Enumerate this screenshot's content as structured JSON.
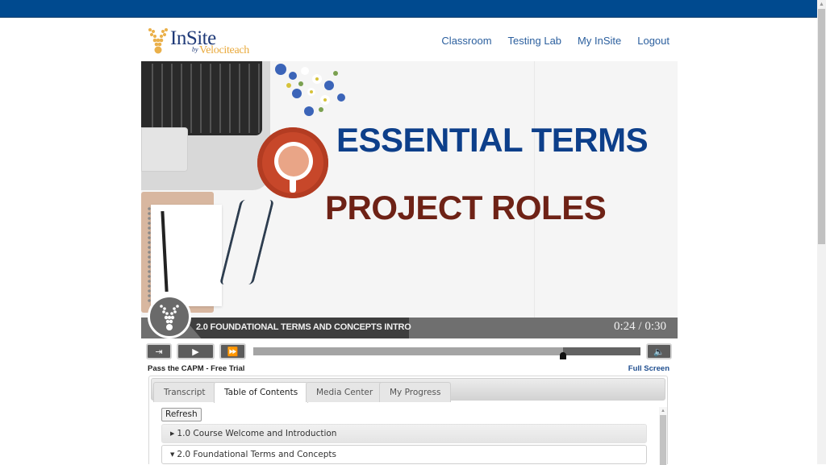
{
  "header": {
    "logo_primary": "InSite",
    "logo_by": "by",
    "logo_secondary": "Velociteach",
    "nav": [
      {
        "label": "Classroom"
      },
      {
        "label": "Testing Lab"
      },
      {
        "label": "My InSite"
      },
      {
        "label": "Logout"
      }
    ]
  },
  "video": {
    "slide_title_line1": "ESSENTIAL TERMS",
    "slide_title_line2": "PROJECT ROLES",
    "caption": "2.0 FOUNDATIONAL TERMS AND CONCEPTS INTRO",
    "time_current": "0:24",
    "time_separator": "/",
    "time_total": "0:30",
    "progress_fraction": 0.8,
    "colors": {
      "title_blue": "#0d3f8a",
      "title_red": "#6e2216"
    }
  },
  "controls": {
    "exit_icon": "exit-icon",
    "play_icon": "play-icon",
    "forward_icon": "fast-forward-icon",
    "volume_icon": "volume-icon"
  },
  "course": {
    "name": "Pass the CAPM - Free Trial",
    "fullscreen_label": "Full Screen"
  },
  "tabs": [
    {
      "label": "Transcript",
      "active": false
    },
    {
      "label": "Table of Contents",
      "active": true
    },
    {
      "label": "Media Center",
      "active": false
    },
    {
      "label": "My Progress",
      "active": false
    }
  ],
  "toc": {
    "refresh_label": "Refresh",
    "items": [
      {
        "label": "1.0 Course Welcome and Introduction",
        "expanded": false
      },
      {
        "label": "2.0 Foundational Terms and Concepts",
        "expanded": true
      }
    ]
  },
  "colors": {
    "topbar": "#004a8f",
    "nav_link": "#2b5f9e",
    "fullscreen_link": "#1f4e8f"
  }
}
